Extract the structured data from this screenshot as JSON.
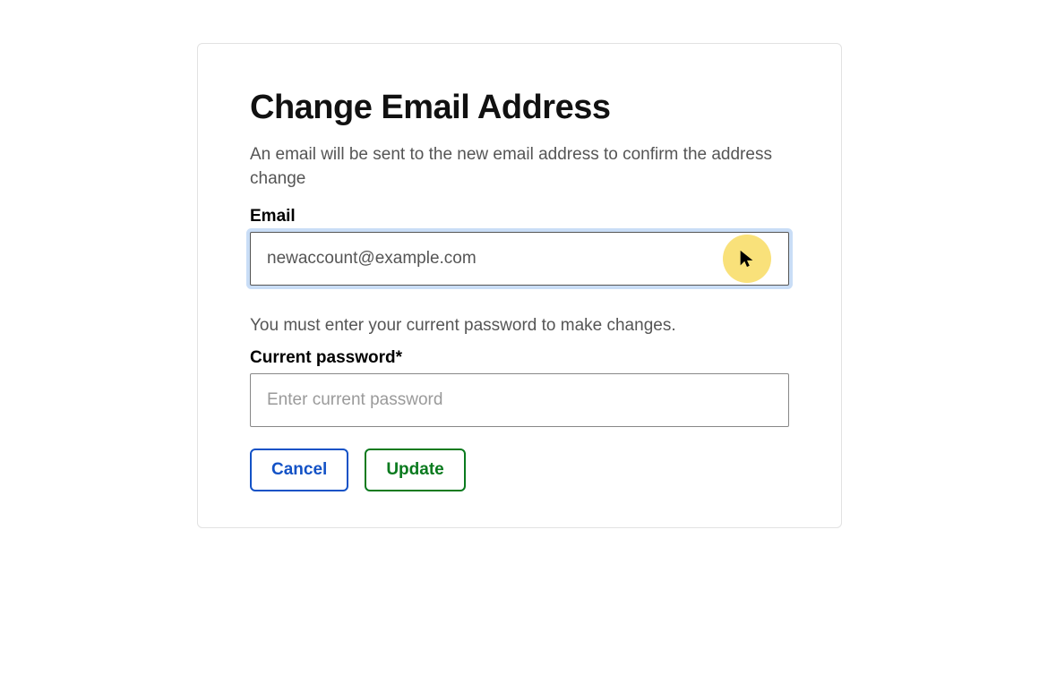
{
  "title": "Change Email Address",
  "description": "An email will be sent to the new email address to confirm the address change",
  "email": {
    "label": "Email",
    "value": "newaccount@example.com"
  },
  "password_note": "You must enter your current password to make changes.",
  "password": {
    "label": "Current password*",
    "placeholder": "Enter current password",
    "value": ""
  },
  "buttons": {
    "cancel": "Cancel",
    "update": "Update"
  }
}
